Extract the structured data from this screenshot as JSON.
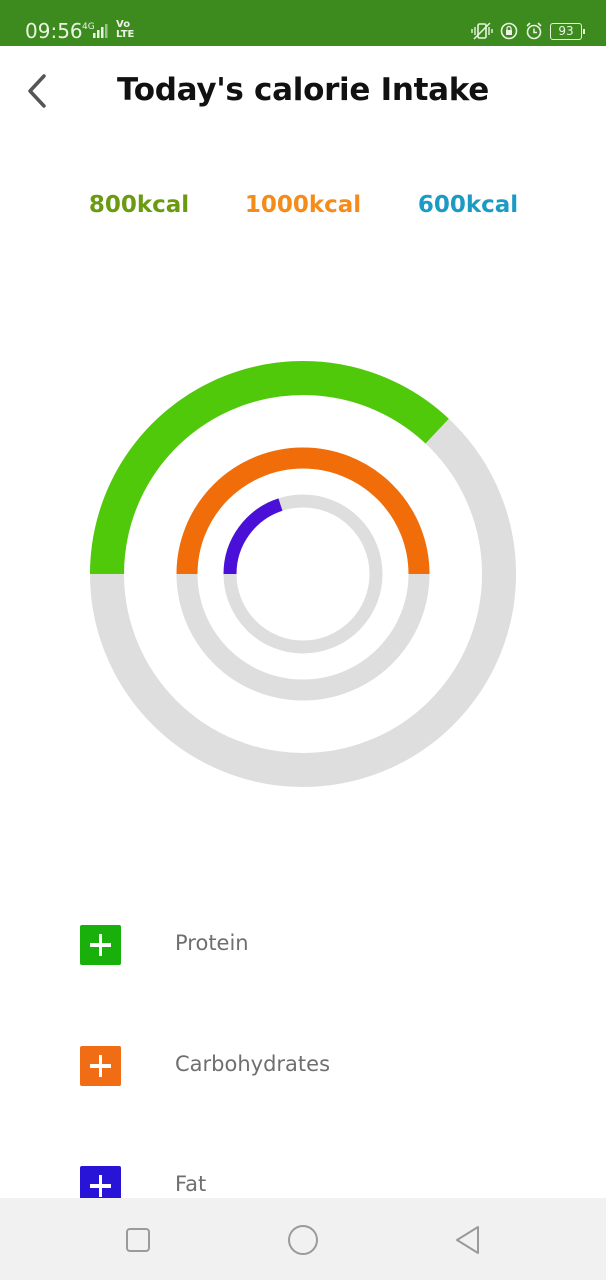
{
  "status_bar": {
    "time": "09:56",
    "network": "4G",
    "volte": "Vo\nLTE",
    "battery": "93",
    "icons": [
      "vibrate-icon",
      "lock-rotation-icon",
      "alarm-icon",
      "battery-icon"
    ]
  },
  "header": {
    "title": "Today's calorie Intake",
    "back_icon": "chevron-left-icon"
  },
  "targets": [
    {
      "label": "800kcal",
      "color": "#6a9a12"
    },
    {
      "label": "1000kcal",
      "color": "#f48c1c"
    },
    {
      "label": "600kcal",
      "color": "#1b9bc4"
    }
  ],
  "chart_data": {
    "type": "radial-progress",
    "track_color": "#dedede",
    "rings": [
      {
        "label": "Protein",
        "fraction": 0.37,
        "color": "#4fc90a"
      },
      {
        "label": "Carbohydrates",
        "fraction": 0.5,
        "color": "#f06d0a"
      },
      {
        "label": "Fat",
        "fraction": 0.2,
        "color": "#4a10d8"
      }
    ]
  },
  "legend": [
    {
      "label": "Protein",
      "color": "#19b00b"
    },
    {
      "label": "Carbohydrates",
      "color": "#f06d16"
    },
    {
      "label": "Fat",
      "color": "#2814d6"
    }
  ],
  "nav_bar": {
    "buttons": [
      "recent-apps-icon",
      "home-icon",
      "back-triangle-icon"
    ]
  }
}
